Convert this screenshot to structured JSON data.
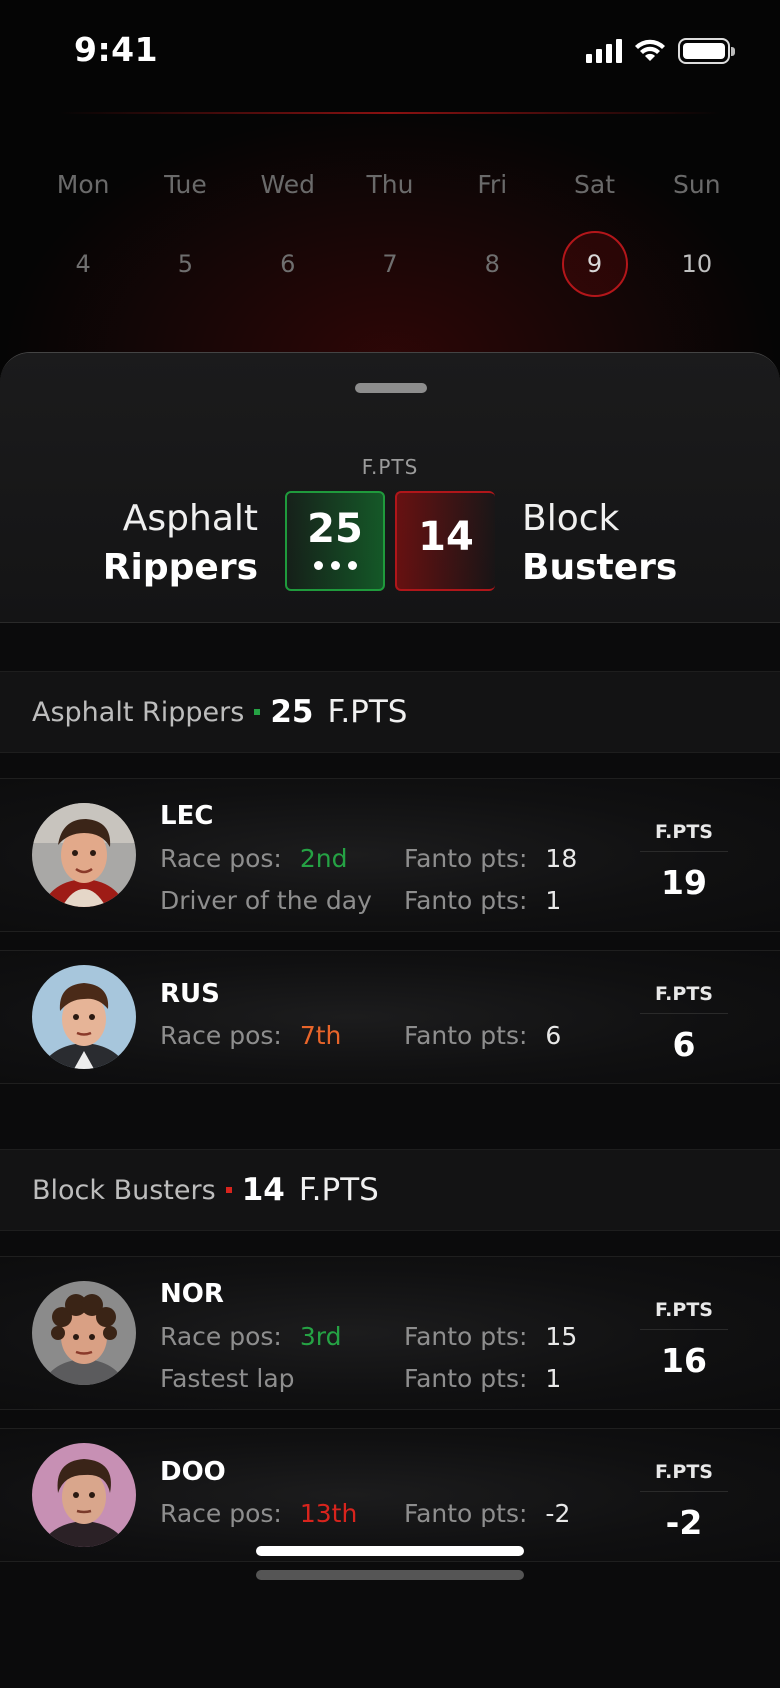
{
  "status_bar": {
    "time": "9:41"
  },
  "calendar": {
    "days": [
      "Mon",
      "Tue",
      "Wed",
      "Thu",
      "Fri",
      "Sat",
      "Sun"
    ],
    "dates": [
      "4",
      "5",
      "6",
      "7",
      "8",
      "9",
      "10"
    ],
    "selected_date": "9"
  },
  "match": {
    "fpts_label": "F.PTS",
    "home": {
      "name_line1": "Asphalt",
      "name_line2": "Rippers",
      "score": "25"
    },
    "away": {
      "name_line1": "Block",
      "name_line2": "Busters",
      "score": "14"
    }
  },
  "teams": [
    {
      "name": "Asphalt Rippers",
      "points": "25",
      "unit": "F.PTS",
      "accent": "#25a244",
      "drivers": [
        {
          "code": "LEC",
          "race_pos_label": "Race pos:",
          "race_pos": "2nd",
          "race_fanto_label": "Fanto pts:",
          "race_fanto": "18",
          "bonus_label": "Driver of the day",
          "bonus_fanto_label": "Fanto pts:",
          "bonus_fanto": "1",
          "fpts_label": "F.PTS",
          "fpts": "19"
        },
        {
          "code": "RUS",
          "race_pos_label": "Race pos:",
          "race_pos": "7th",
          "race_fanto_label": "Fanto pts:",
          "race_fanto": "6",
          "fpts_label": "F.PTS",
          "fpts": "6"
        }
      ]
    },
    {
      "name": "Block Busters",
      "points": "14",
      "unit": "F.PTS",
      "accent": "#d8241d",
      "drivers": [
        {
          "code": "NOR",
          "race_pos_label": "Race pos:",
          "race_pos": "3rd",
          "race_fanto_label": "Fanto pts:",
          "race_fanto": "15",
          "bonus_label": "Fastest lap",
          "bonus_fanto_label": "Fanto pts:",
          "bonus_fanto": "1",
          "fpts_label": "F.PTS",
          "fpts": "16"
        },
        {
          "code": "DOO",
          "race_pos_label": "Race pos:",
          "race_pos": "13th",
          "race_fanto_label": "Fanto pts:",
          "race_fanto": "-2",
          "fpts_label": "F.PTS",
          "fpts": "-2"
        }
      ]
    }
  ]
}
